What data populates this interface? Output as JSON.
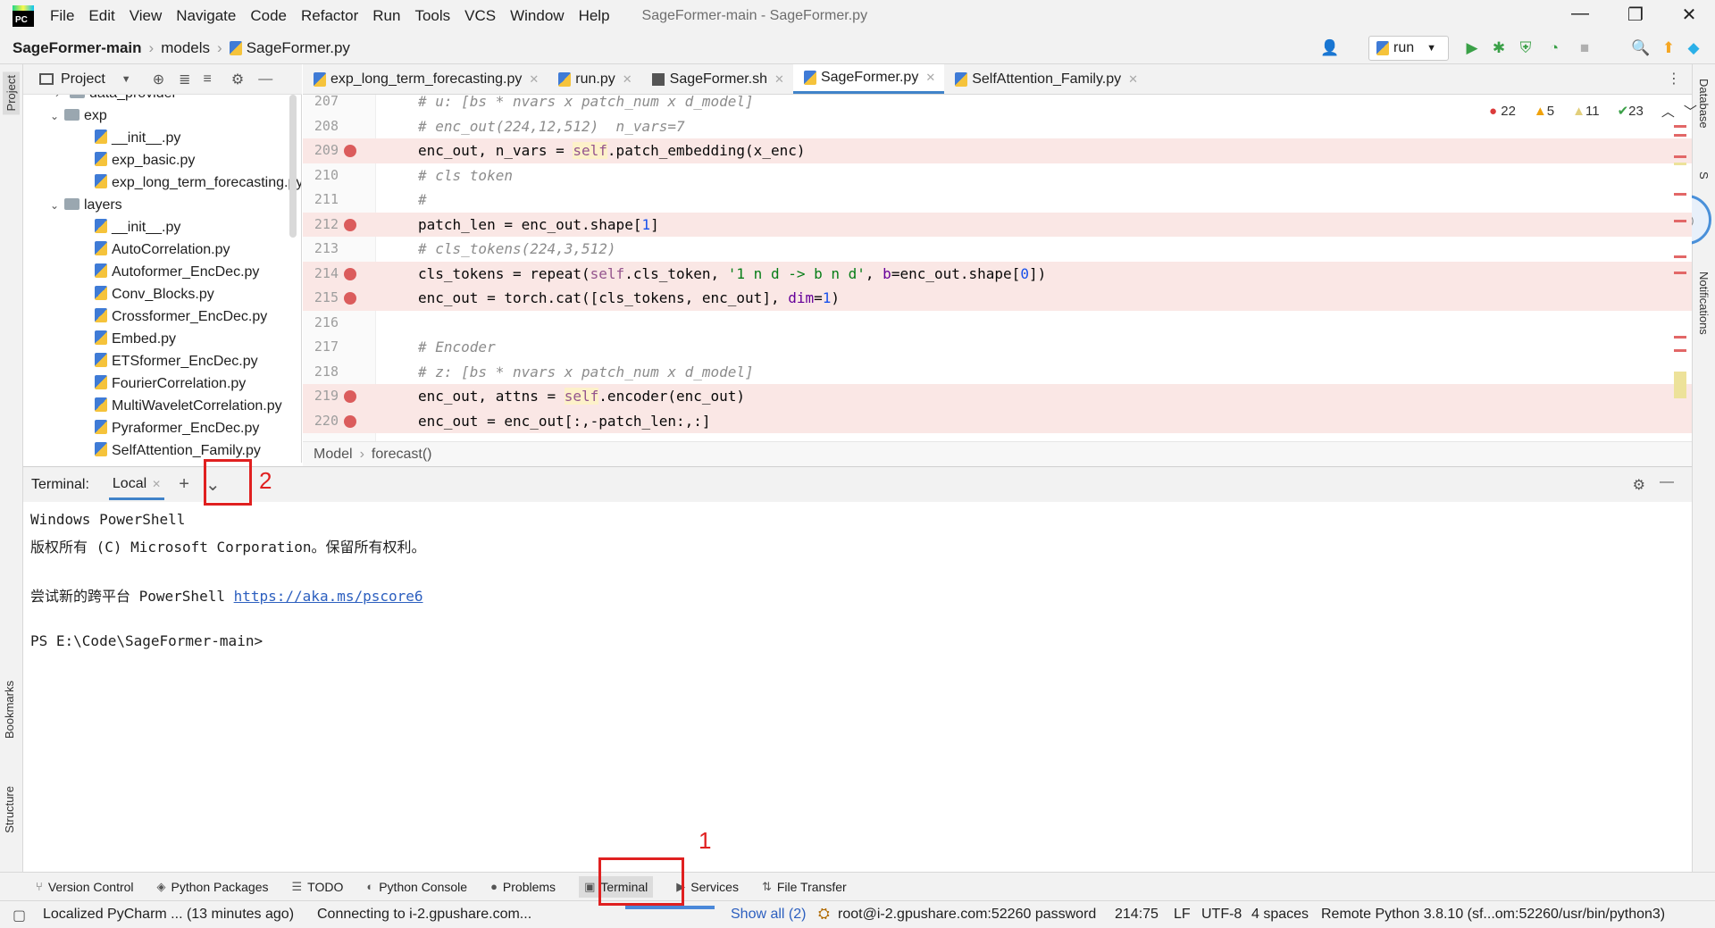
{
  "window": {
    "title": "SageFormer-main - SageFormer.py",
    "menu": [
      "File",
      "Edit",
      "View",
      "Navigate",
      "Code",
      "Refactor",
      "Run",
      "Tools",
      "VCS",
      "Window",
      "Help"
    ],
    "controls": {
      "minimize": "—",
      "restore": "❐",
      "close": "✕"
    }
  },
  "navbar": {
    "project": "SageFormer-main",
    "folder": "models",
    "file": "SageFormer.py",
    "run_config": "run"
  },
  "left_stripe": {
    "project": "Project",
    "bookmarks": "Bookmarks",
    "structure": "Structure"
  },
  "right_stripe": {
    "database": "Database",
    "notifications": "Notifications",
    "sciview": "S"
  },
  "project_panel": {
    "title": "Project",
    "tree": [
      {
        "label": "data_provider",
        "type": "folder",
        "depth": 1
      },
      {
        "label": "exp",
        "type": "folder",
        "depth": 1,
        "open": true
      },
      {
        "label": "__init__.py",
        "type": "py",
        "depth": 2
      },
      {
        "label": "exp_basic.py",
        "type": "py",
        "depth": 2
      },
      {
        "label": "exp_long_term_forecasting.py",
        "type": "py",
        "depth": 2
      },
      {
        "label": "layers",
        "type": "folder",
        "depth": 1,
        "open": true
      },
      {
        "label": "__init__.py",
        "type": "py",
        "depth": 2
      },
      {
        "label": "AutoCorrelation.py",
        "type": "py",
        "depth": 2
      },
      {
        "label": "Autoformer_EncDec.py",
        "type": "py",
        "depth": 2
      },
      {
        "label": "Conv_Blocks.py",
        "type": "py",
        "depth": 2
      },
      {
        "label": "Crossformer_EncDec.py",
        "type": "py",
        "depth": 2
      },
      {
        "label": "Embed.py",
        "type": "py",
        "depth": 2
      },
      {
        "label": "ETSformer_EncDec.py",
        "type": "py",
        "depth": 2
      },
      {
        "label": "FourierCorrelation.py",
        "type": "py",
        "depth": 2
      },
      {
        "label": "MultiWaveletCorrelation.py",
        "type": "py",
        "depth": 2
      },
      {
        "label": "Pyraformer_EncDec.py",
        "type": "py",
        "depth": 2
      },
      {
        "label": "SelfAttention_Family.py",
        "type": "py",
        "depth": 2
      }
    ]
  },
  "editor_tabs": [
    {
      "label": "exp_long_term_forecasting.py",
      "active": false
    },
    {
      "label": "run.py",
      "active": false
    },
    {
      "label": "SageFormer.sh",
      "active": false
    },
    {
      "label": "SageFormer.py",
      "active": true
    },
    {
      "label": "SelfAttention_Family.py",
      "active": false
    }
  ],
  "inspections": {
    "errors": "22",
    "warnings": "5",
    "weak_warnings": "11",
    "typos": "23"
  },
  "code": [
    {
      "n": "207",
      "bp": false,
      "html": "<span class='cm'># u: [bs * nvars x patch_num x d_model]</span>"
    },
    {
      "n": "208",
      "bp": false,
      "html": "<span class='cm'># enc_out(224,12,512)  n_vars=7</span>"
    },
    {
      "n": "209",
      "bp": true,
      "html": "enc_out, n_vars = <span class='selfhl'>self</span>.patch_embedding(x_enc)"
    },
    {
      "n": "210",
      "bp": false,
      "html": "<span class='cm'># cls token</span>"
    },
    {
      "n": "211",
      "bp": false,
      "html": "<span class='cm'>#</span>"
    },
    {
      "n": "212",
      "bp": true,
      "html": "patch_len = enc_out.shape[<span class='num'>1</span>]"
    },
    {
      "n": "213",
      "bp": false,
      "html": "<span class='cm'># cls_tokens(224,3,512)</span>"
    },
    {
      "n": "214",
      "bp": true,
      "html": "cls_tokens = repeat(<span class='kw-self'>self</span>.cls_token, <span class='str'>'1 n d -&gt; b n d'</span>, <span class='param'>b</span>=enc_out.shape[<span class='num'>0</span>])"
    },
    {
      "n": "215",
      "bp": true,
      "html": "enc_out = torch.cat([cls_tokens, enc_out], <span class='param'>dim</span>=<span class='num'>1</span>)"
    },
    {
      "n": "216",
      "bp": false,
      "html": ""
    },
    {
      "n": "217",
      "bp": false,
      "html": "<span class='cm'># Encoder</span>"
    },
    {
      "n": "218",
      "bp": false,
      "html": "<span class='cm'># z: [bs * nvars x patch_num x d_model]</span>"
    },
    {
      "n": "219",
      "bp": true,
      "html": "enc_out, attns = <span class='selfhl'>self</span>.encoder(enc_out)"
    },
    {
      "n": "220",
      "bp": true,
      "html": "enc_out = enc_out[:,-patch_len:,:]"
    }
  ],
  "breadcrumb": {
    "cls": "Model",
    "method": "forecast()"
  },
  "terminal": {
    "label": "Terminal:",
    "tab": "Local",
    "add": "+",
    "dropdown": "⌄",
    "lines": [
      "Windows PowerShell",
      "版权所有 (C) Microsoft Corporation。保留所有权利。",
      "",
      "尝试新的跨平台 PowerShell ",
      "",
      "PS E:\\Code\\SageFormer-main>"
    ],
    "link": "https://aka.ms/pscore6"
  },
  "toolwindows": [
    "Version Control",
    "Python Packages",
    "TODO",
    "Python Console",
    "Problems",
    "Terminal",
    "Services",
    "File Transfer"
  ],
  "statusbar": {
    "message": "Localized PyCharm ... (13 minutes ago)",
    "task": "Connecting to i-2.gpushare.com...",
    "show_all": "Show all (2)",
    "remote": "root@i-2.gpushare.com:52260 password",
    "position": "214:75",
    "line_sep": "LF",
    "encoding": "UTF-8",
    "indent": "4 spaces",
    "interpreter": "Remote Python 3.8.10 (sf...om:52260/usr/bin/python3)"
  },
  "annotations": {
    "box1": "1",
    "box2": "2"
  },
  "colors": {
    "breakpoint": "#db5c5c",
    "bp_line": "#fae7e5",
    "accent": "#4083c9",
    "annotation": "#e02020"
  }
}
